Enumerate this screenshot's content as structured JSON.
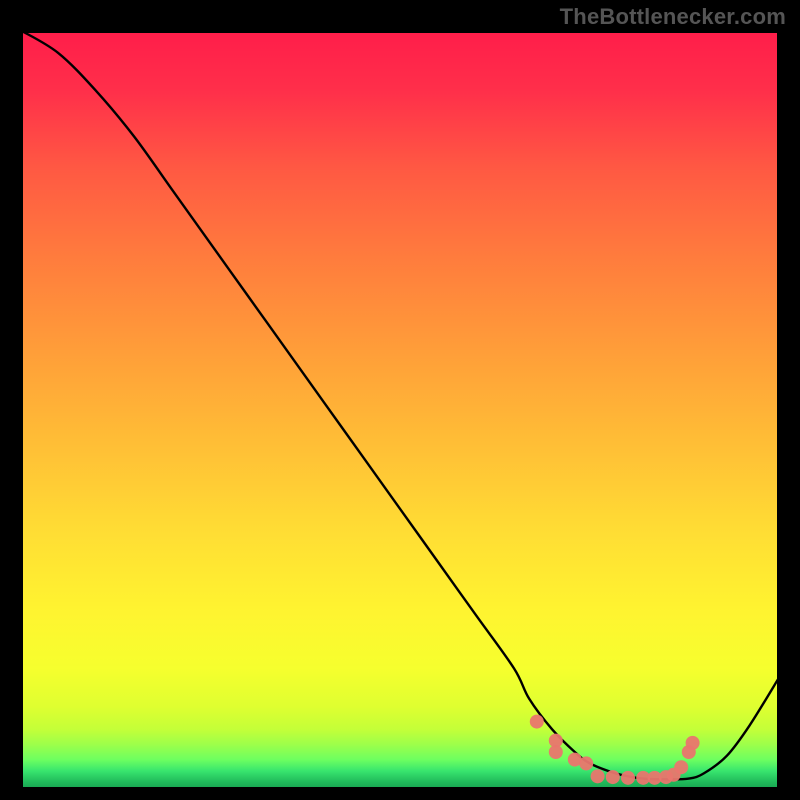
{
  "watermark": "TheBottlenecker.com",
  "chart_data": {
    "type": "line",
    "xlim": [
      0,
      100
    ],
    "ylim": [
      0,
      100
    ],
    "xlabel": "",
    "ylabel": "",
    "title": "",
    "grid": false,
    "background_gradient": "red-yellow-green (green narrow band at bottom)",
    "series": [
      {
        "name": "curve",
        "x": [
          0,
          5,
          10,
          15,
          20,
          25,
          30,
          35,
          40,
          45,
          50,
          55,
          60,
          65,
          67,
          70,
          73,
          75,
          78,
          80,
          82,
          85,
          88,
          90,
          93,
          96,
          100
        ],
        "y": [
          100,
          97,
          92,
          86,
          79,
          72,
          65,
          58,
          51,
          44,
          37,
          30,
          23,
          16,
          12,
          8,
          5,
          3.5,
          2.3,
          1.8,
          1.5,
          1.4,
          1.5,
          2.2,
          4.5,
          8.5,
          15
        ]
      },
      {
        "name": "marker-cluster",
        "type": "scatter",
        "x": [
          68,
          70.5,
          70.5,
          73,
          74.5,
          76,
          78,
          80,
          82,
          83.5,
          85,
          86,
          87,
          88,
          88.5
        ],
        "y": [
          9,
          6.5,
          5,
          4,
          3.5,
          1.8,
          1.7,
          1.6,
          1.6,
          1.6,
          1.7,
          2.0,
          3.0,
          5.0,
          6.2
        ]
      }
    ],
    "gradient_stops": [
      {
        "offset": 0.0,
        "color": "#ff1d4a"
      },
      {
        "offset": 0.08,
        "color": "#ff2f4a"
      },
      {
        "offset": 0.18,
        "color": "#ff5843"
      },
      {
        "offset": 0.3,
        "color": "#ff7c3d"
      },
      {
        "offset": 0.42,
        "color": "#ff9d39"
      },
      {
        "offset": 0.54,
        "color": "#ffbd36"
      },
      {
        "offset": 0.66,
        "color": "#ffdd34"
      },
      {
        "offset": 0.76,
        "color": "#fff330"
      },
      {
        "offset": 0.84,
        "color": "#f6ff2e"
      },
      {
        "offset": 0.89,
        "color": "#dfff30"
      },
      {
        "offset": 0.92,
        "color": "#c4ff38"
      },
      {
        "offset": 0.94,
        "color": "#9dff4a"
      },
      {
        "offset": 0.96,
        "color": "#6dff60"
      },
      {
        "offset": 0.975,
        "color": "#38e56e"
      },
      {
        "offset": 0.99,
        "color": "#1fb85a"
      },
      {
        "offset": 1.0,
        "color": "#17a050"
      }
    ]
  }
}
